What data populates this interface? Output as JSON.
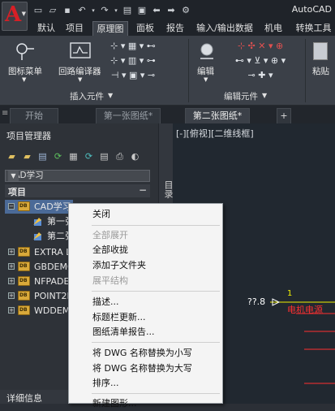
{
  "title_bar": {
    "app_title": "AutoCAD",
    "qat_icons": [
      "new-icon",
      "open-icon",
      "save-icon",
      "undo-icon",
      "undo-dropdown-icon",
      "redo-icon",
      "redo-dropdown-icon",
      "print-icon",
      "print-preview-icon",
      "back-icon",
      "forward-icon",
      "customize-icon"
    ]
  },
  "ribbon_tabs": [
    {
      "label": "默认"
    },
    {
      "label": "项目"
    },
    {
      "label": "原理图"
    },
    {
      "label": "面板"
    },
    {
      "label": "报告"
    },
    {
      "label": "输入/输出数据"
    },
    {
      "label": "机电"
    },
    {
      "label": "转换工具"
    }
  ],
  "ribbon": {
    "icon_menu": "图标菜单",
    "circuit_builder": "回路编译器",
    "insert_group": "插入元件",
    "edit": "编辑",
    "edit_group": "编辑元件",
    "paste": "粘贴"
  },
  "doc_tabs": {
    "start": "开始",
    "drawing1": "第一张图纸*",
    "drawing2": "第二张图纸*",
    "new": "+"
  },
  "project_manager": {
    "title": "项目管理器",
    "current_project": "CAD学习",
    "section": "项目",
    "side_tab": "目录",
    "details": "详细信息",
    "tree": [
      {
        "label": "CAD学习",
        "type": "project"
      },
      {
        "label": "第一张",
        "type": "drawing"
      },
      {
        "label": "第二张",
        "type": "drawing"
      },
      {
        "label": "EXTRA L",
        "type": "project"
      },
      {
        "label": "GBDEMO",
        "type": "project"
      },
      {
        "label": "NFPADE",
        "type": "project"
      },
      {
        "label": "POINT2I",
        "type": "project"
      },
      {
        "label": "WDDEM",
        "type": "project"
      }
    ]
  },
  "drawing": {
    "view_label": "[-][俯视][二维线框]",
    "ref_text": "??.8",
    "wire_no": "1",
    "component_label": "电机电源"
  },
  "context_menu": [
    {
      "label": "关闭",
      "disabled": false
    },
    {
      "label": "全部展开",
      "disabled": true
    },
    {
      "label": "全部收拢",
      "disabled": false
    },
    {
      "label": "添加子文件夹",
      "disabled": false
    },
    {
      "label": "展平结构",
      "disabled": true
    },
    {
      "label": "描述...",
      "disabled": false
    },
    {
      "label": "标题栏更新...",
      "disabled": false
    },
    {
      "label": "图纸清单报告...",
      "disabled": false
    },
    {
      "label": "将 DWG 名称替换为小写",
      "disabled": false
    },
    {
      "label": "将 DWG 名称替换为大写",
      "disabled": false
    },
    {
      "label": "排序...",
      "disabled": false
    },
    {
      "label": "新建图形...",
      "disabled": false
    }
  ],
  "colors": {
    "selection": "#4b6a97",
    "accent_red": "#d81f26",
    "wire_yellow": "#f0f000",
    "wire_red": "#ff3030"
  }
}
